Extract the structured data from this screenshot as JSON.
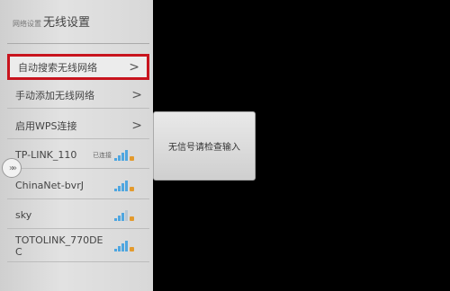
{
  "header": {
    "breadcrumb": "网络设置",
    "title": "无线设置"
  },
  "menu": [
    {
      "label": "自动搜索无线网络",
      "chevron": ">"
    },
    {
      "label": "手动添加无线网络",
      "chevron": ">"
    },
    {
      "label": "启用WPS连接",
      "chevron": ">"
    }
  ],
  "networks": [
    {
      "ssid": "TP-LINK_110",
      "status": "已连接",
      "bars": 4
    },
    {
      "ssid": "ChinaNet-bvrJ",
      "status": "",
      "bars": 4
    },
    {
      "ssid": "sky",
      "status": "",
      "bars": 3
    },
    {
      "ssid": "TOTOLINK_770DE\nC",
      "status": "",
      "bars": 4
    }
  ],
  "dialog": {
    "message": "无信号请检查输入"
  },
  "handle": {
    "glyph": "»»"
  },
  "colors": {
    "selection_border": "#c8141e",
    "signal": "#4fa6e0",
    "lock": "#e39a2d"
  },
  "icons": {
    "chevron": "chevron-right-icon",
    "signal": "wifi-signal-icon",
    "handle": "double-chevron-icon"
  }
}
